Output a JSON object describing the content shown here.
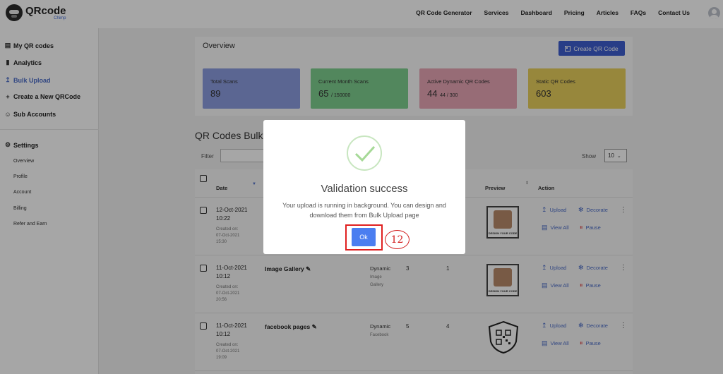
{
  "brand": {
    "name": "QRcode",
    "sub": "Chimp"
  },
  "nav": {
    "items": [
      "QR Code Generator",
      "Services",
      "Dashboard",
      "Pricing",
      "Articles",
      "FAQs",
      "Contact Us"
    ]
  },
  "sidebar": {
    "items": [
      {
        "label": "My QR codes",
        "icon": "list-icon"
      },
      {
        "label": "Analytics",
        "icon": "bar-chart-icon"
      },
      {
        "label": "Bulk Upload",
        "icon": "upload-icon",
        "active": true
      },
      {
        "label": "Create a New QRCode",
        "icon": "plus-icon"
      },
      {
        "label": "Sub Accounts",
        "icon": "user-icon"
      }
    ],
    "settings": {
      "label": "Settings",
      "icon": "gear-icon"
    },
    "settings_items": [
      "Overview",
      "Profile",
      "Account",
      "Billing",
      "Refer and Earn"
    ],
    "active_color": "#4b6cc8"
  },
  "overview": {
    "title": "Overview",
    "create_label": "Create QR Code",
    "stats": [
      {
        "label": "Total Scans",
        "value": "89",
        "sub": "",
        "color": "#8c9de0"
      },
      {
        "label": "Current Month Scans",
        "value": "65",
        "sub": "/ 150000",
        "color": "#7ecf8f"
      },
      {
        "label": "Active Dynamic QR Codes",
        "value": "44",
        "sub": "44 / 300",
        "color": "#e9a7b6"
      },
      {
        "label": "Static QR Codes",
        "value": "603",
        "sub": "",
        "color": "#e8cf5d"
      }
    ]
  },
  "bulk": {
    "title": "QR Codes Bulk U",
    "filter_label": "Filter",
    "show_label": "Show",
    "show_value": "10",
    "headers": {
      "date": "Date",
      "preview": "Preview",
      "action": "Action"
    },
    "rows": [
      {
        "date": "12-Oct-2021",
        "time": "10:22",
        "created_label": "Created on:",
        "created": "07-Oct-2021",
        "created_time": "15:30",
        "name": "",
        "type": "",
        "type_sub1": "",
        "type_sub2": "",
        "n1": "",
        "n2": ""
      },
      {
        "date": "11-Oct-2021",
        "time": "10:12",
        "created_label": "Created on:",
        "created": "07-Oct-2021",
        "created_time": "20:56",
        "name": "Image Gallery",
        "type": "Dynamic",
        "type_sub1": "Image",
        "type_sub2": "Gallery",
        "n1": "3",
        "n2": "1"
      },
      {
        "date": "11-Oct-2021",
        "time": "10:12",
        "created_label": "Created on:",
        "created": "07-Oct-2021",
        "created_time": "19:09",
        "name": "facebook pages",
        "type": "Dynamic",
        "type_sub1": "Facebook",
        "type_sub2": "",
        "n1": "5",
        "n2": "4"
      }
    ],
    "preview_caption": "DESIGN YOUR CODE",
    "actions": {
      "upload": "Upload",
      "decorate": "Decorate",
      "view_all": "View All",
      "pause": "Pause"
    }
  },
  "modal": {
    "title": "Validation success",
    "body": "Your upload is running in background. You can design and download them from Bulk Upload page",
    "ok_label": "Ok",
    "annotation": "12"
  }
}
